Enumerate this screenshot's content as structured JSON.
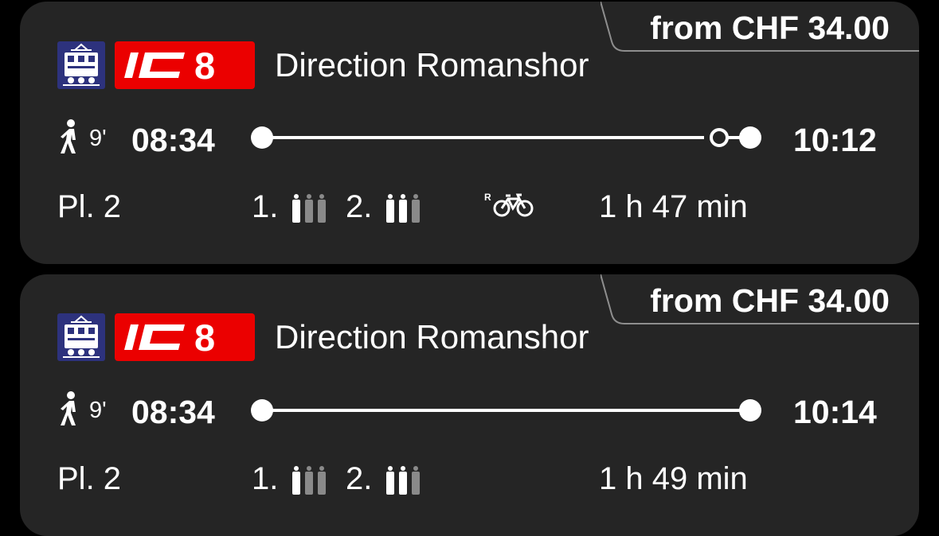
{
  "connections": [
    {
      "price": "from CHF 34.00",
      "product": "IC",
      "line": "8",
      "direction": "Direction Romanshor",
      "walk_time": "9'",
      "departure": "08:34",
      "arrival": "10:12",
      "platform": "Pl. 2",
      "first_class_label": "1.",
      "second_class_label": "2.",
      "first_class_occupancy": 1,
      "second_class_occupancy": 2,
      "bike_reservation": true,
      "duration": "1 h 47 min"
    },
    {
      "price": "from CHF 34.00",
      "product": "IC",
      "line": "8",
      "direction": "Direction Romanshor",
      "walk_time": "9'",
      "departure": "08:34",
      "arrival": "10:14",
      "platform": "Pl. 2",
      "first_class_label": "1.",
      "second_class_label": "2.",
      "first_class_occupancy": 1,
      "second_class_occupancy": 2,
      "bike_reservation": false,
      "duration": "1 h 49 min"
    }
  ],
  "colors": {
    "card_bg": "#252525",
    "badge_red": "#eb0000",
    "train_icon_blue": "#2d327d",
    "occupancy_inactive": "#8a8a8a"
  },
  "icons": {
    "train": "train-icon",
    "walk": "walking-person-icon",
    "bike": "bike-reservation-icon",
    "occupancy": "occupancy-person-icon"
  }
}
